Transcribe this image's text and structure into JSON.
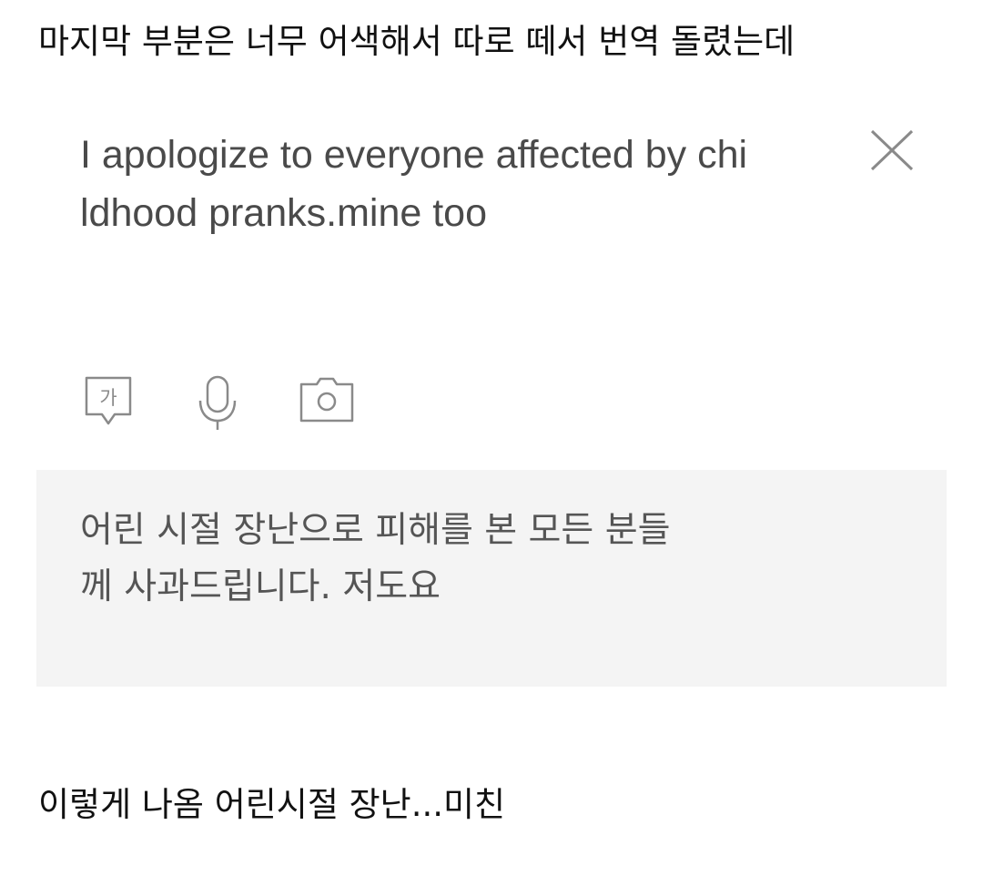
{
  "caption_top": "마지막 부분은 너무 어색해서 따로 떼서 번역 돌렸는데",
  "translator": {
    "source_text": "I apologize to everyone affected by chi\nldhood pranks.mine too",
    "clear_icon": "close-x-icon",
    "input_tools": {
      "keyboard_icon": "handwriting-ga-icon",
      "keyboard_glyph": "가",
      "mic_icon": "microphone-icon",
      "camera_icon": "camera-icon"
    },
    "result_text": "어린 시절 장난으로 피해를 본 모든 분들\n께 사과드립니다. 저도요"
  },
  "caption_bottom": "이렇게 나옴 어린시절 장난...미친",
  "colors": {
    "result_background": "#f4f4f4",
    "icon_stroke": "#8a8a8a"
  }
}
